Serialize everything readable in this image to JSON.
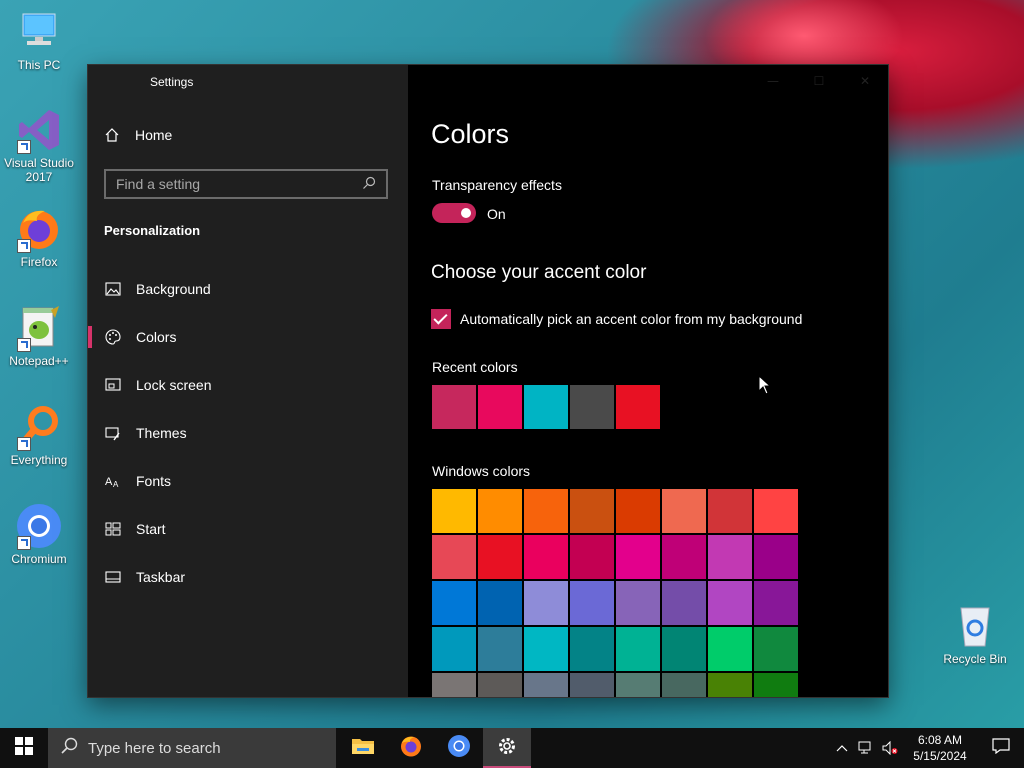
{
  "desktop": {
    "icons": [
      {
        "label": "This PC"
      },
      {
        "label": "Visual Studio 2017"
      },
      {
        "label": "Firefox"
      },
      {
        "label": "Notepad++"
      },
      {
        "label": "Everything"
      },
      {
        "label": "Chromium"
      },
      {
        "label": "Recycle Bin"
      }
    ]
  },
  "window": {
    "title": "Settings",
    "caption_buttons": {
      "minimize": "—",
      "maximize": "☐",
      "close": "✕"
    }
  },
  "nav": {
    "home": "Home",
    "search_placeholder": "Find a setting",
    "section": "Personalization",
    "items": [
      {
        "label": "Background",
        "icon": "image-icon"
      },
      {
        "label": "Colors",
        "icon": "palette-icon",
        "active": true
      },
      {
        "label": "Lock screen",
        "icon": "lock-screen-icon"
      },
      {
        "label": "Themes",
        "icon": "brush-icon"
      },
      {
        "label": "Fonts",
        "icon": "font-icon"
      },
      {
        "label": "Start",
        "icon": "start-icon"
      },
      {
        "label": "Taskbar",
        "icon": "taskbar-icon"
      }
    ]
  },
  "content": {
    "title": "Colors",
    "transparency_label": "Transparency effects",
    "transparency_state": "On",
    "accent_heading": "Choose your accent color",
    "auto_pick_label": "Automatically pick an accent color from my background",
    "auto_pick_checked": true,
    "recent_label": "Recent colors",
    "recent_colors": [
      "#c6285d",
      "#e8095d",
      "#00b4c4",
      "#4a4a4a",
      "#e81123"
    ],
    "windows_label": "Windows colors",
    "windows_colors": [
      "#ffb900",
      "#ff8c00",
      "#f7630c",
      "#ca5010",
      "#da3b01",
      "#ef6950",
      "#d13438",
      "#ff4343",
      "#e74856",
      "#e81123",
      "#ea005e",
      "#c30052",
      "#e3008c",
      "#bf0077",
      "#c239b3",
      "#9a0089",
      "#0078d7",
      "#0063b1",
      "#8e8cd8",
      "#6b69d6",
      "#8764b8",
      "#744da9",
      "#b146c2",
      "#881798",
      "#0099bc",
      "#2d7d9a",
      "#00b7c3",
      "#038387",
      "#00b294",
      "#018574",
      "#00cc6a",
      "#10893e",
      "#7a7574",
      "#5d5a58",
      "#68768a",
      "#515c6b",
      "#567c73",
      "#486860",
      "#498205",
      "#107c10"
    ]
  },
  "taskbar": {
    "search_placeholder": "Type here to search",
    "apps": [
      "file-explorer-icon",
      "firefox-icon",
      "chromium-icon",
      "settings-icon"
    ],
    "time": "6:08 AM",
    "date": "5/15/2024"
  }
}
